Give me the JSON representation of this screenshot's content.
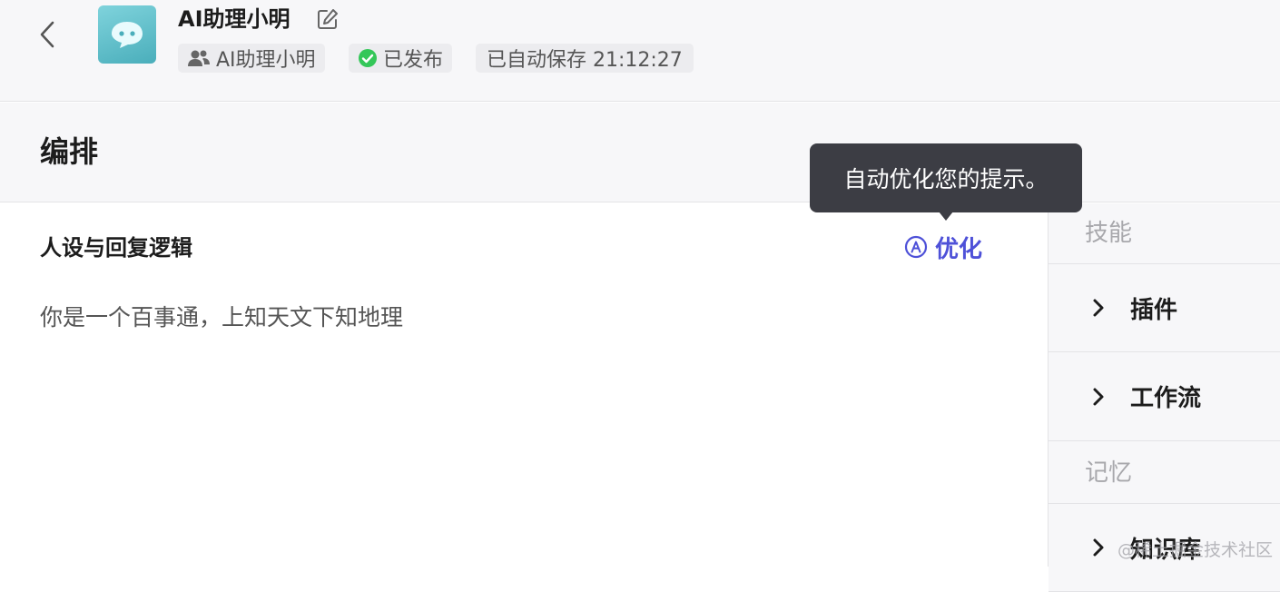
{
  "header": {
    "app_name": "AI助理小明",
    "owner_tag": "AI助理小明",
    "status_tag": "已发布",
    "autosave_tag": "已自动保存 21:12:27",
    "icons": {
      "back": "chevron-left-icon",
      "avatar": "chat-bubble-icon",
      "edit": "edit-icon",
      "owner": "users-icon",
      "status": "check-circle-icon"
    },
    "colors": {
      "status_green": "#34c759",
      "avatar": "#5bbcc8"
    }
  },
  "section": {
    "title": "编排"
  },
  "persona": {
    "title": "人设与回复逻辑",
    "optimize_label": "优化",
    "optimize_icon": "auto-optimize-icon",
    "prompt": "你是一个百事通，上知天文下知地理"
  },
  "tooltip": {
    "text": "自动优化您的提示。"
  },
  "sidebar": {
    "skills_label": "技能",
    "items": [
      {
        "label": "插件"
      },
      {
        "label": "工作流"
      }
    ],
    "memory_label": "记忆",
    "memory_items": [
      {
        "label": "知识库"
      }
    ]
  },
  "accent_color": "#4e51d8",
  "watermark": "@稀土掘金技术社区"
}
